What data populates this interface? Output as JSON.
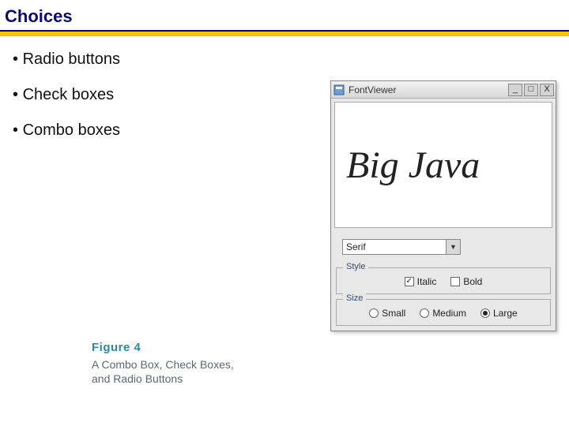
{
  "title": "Choices",
  "bullets": [
    "Radio buttons",
    "Check boxes",
    "Combo boxes"
  ],
  "figure": {
    "number": "Figure 4",
    "caption_line1": "A Combo Box, Check Boxes,",
    "caption_line2": "and Radio Buttons"
  },
  "window": {
    "title": "FontViewer",
    "min_glyph": "_",
    "max_glyph": "□",
    "close_glyph": "X",
    "sample_text": "Big Java",
    "combo_selected": "Serif",
    "combo_arrow": "▼",
    "style": {
      "legend": "Style",
      "italic": {
        "label": "Italic",
        "checked": true,
        "mark": "✓"
      },
      "bold": {
        "label": "Bold",
        "checked": false,
        "mark": ""
      }
    },
    "size": {
      "legend": "Size",
      "options": [
        {
          "label": "Small",
          "selected": false
        },
        {
          "label": "Medium",
          "selected": false
        },
        {
          "label": "Large",
          "selected": true
        }
      ]
    }
  }
}
